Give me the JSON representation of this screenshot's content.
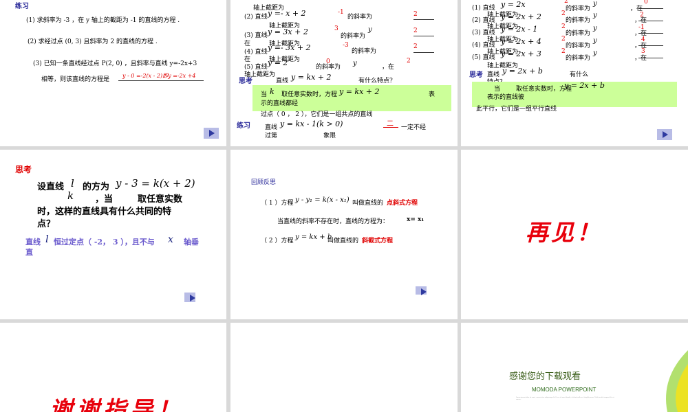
{
  "slide1": {
    "heading": "练习",
    "q1": "(1) 求斜率为 -3 ，在 y 轴上的截距为 -1 的直线的方程 .",
    "q2": "(2) 求经过点 (0, 3) 且斜率为 2 的直线的方程 .",
    "q3a": "(3) 已知一条直线经过点 P(2, 0) ，且斜率与直线 y=-2x+3",
    "q3b": "相等，则该直线的方程是",
    "q3ans": "y - 0 =-2(x - 2)即y =-2x +4"
  },
  "slide2": {
    "r2a": "(2) 直线",
    "r2eq": "y =- x + 2",
    "r2k": "-1",
    "r2s": "的斜率为",
    "r2b": "2",
    "r2c": "轴上截距为",
    "r3a": "(3) 直线",
    "r3eq": "y = 3x + 2",
    "r3k": "3",
    "r3s": "的斜率为",
    "r3y": "y",
    "r3b": "2",
    "r3c": "在",
    "r3d": "轴上截距为",
    "r4a": "(4) 直线",
    "r4eq": "y =- 3x + 2",
    "r4k": "-3",
    "r4s": "的斜率为",
    "r4b": "2",
    "r4c": "在",
    "r4d": "轴上截距为",
    "r5a": "(5) 直线",
    "r5eq": "y = 2",
    "r5k": "0",
    "r5s": "的斜率为",
    "r5y": "y",
    "r5z": "，在",
    "r5b": "2",
    "r5c": "轴上截距为",
    "r1c": "轴上截距为",
    "think": "思考",
    "think_line": "直线",
    "think_eq": "y = kx + 2",
    "think_q": "有什么特点?",
    "box1a": "当",
    "box1k": "k",
    "box1b": "取任意实数时，方程",
    "box1eq": "y = kx + 2",
    "box1c": "表",
    "box1d": "示的直线都经",
    "pt_line": "过点（ 0 ， 2 ），它们是一组共点的直线",
    "ex": "练习",
    "ex_line": "直线",
    "ex_eq": "y = kx - 1(k > 0)",
    "ex_ans": "二",
    "ex_end": "一定不经",
    "ex_b": "过第",
    "ex_c": "象限"
  },
  "slide3": {
    "r1": "(1) 直线",
    "r1eq": "y = 2x",
    "r1k": "2",
    "r1s": "的斜率为",
    "r1y": "y",
    "r1z": "，在",
    "r1b": "0",
    "r1c": "轴上截距为",
    "r2": "(2) 直线",
    "r2eq": "y = 2x + 2",
    "r2k": "2",
    "r2b": "2",
    "r3": "(3) 直线",
    "r3eq": "y = 2x - 1",
    "r3k": "2",
    "r3b": "-1",
    "r4": "(4) 直线",
    "r4eq": "y = 2x + 4",
    "r4k": "2",
    "r4b": "4",
    "r5": "(5) 直线",
    "r5eq": "y = 2x + 3",
    "r5k": "2",
    "r5b": "3",
    "r5c": "轴上截距为",
    "think": "思考",
    "think_line": "直线",
    "think_eq": "y = 2x + b",
    "think_q": "有什么",
    "think_q2": "特点？",
    "box_a": "当",
    "box_b": "取任意实数时，方程",
    "box_eq": "y = 2x + b",
    "box_c": "表示的直线彼",
    "par_line": "此平行，它们是一组平行直线"
  },
  "slide4": {
    "heading": "思考",
    "l1a": "设直线",
    "l1l": "l",
    "l1b": "的方为",
    "l1eq": "y - 3 = k(x + 2)",
    "l2k": "k",
    "l2a": "，当",
    "l2b": "取任意实数",
    "l3": "时，这样的直线具有什么共同的特",
    "l4": "点？",
    "ans_a": "直线",
    "ans_l": "l",
    "ans_b": "恒过定点（ -2， 3 ），且不与",
    "ans_x": "x",
    "ans_c": "轴垂",
    "ans_d": "直"
  },
  "slide5": {
    "heading": "回顾反思",
    "p1a": "（ 1 ）方程",
    "p1eq": "y - y₁ = k(x - x₁)",
    "p1b": "叫做直线的",
    "p1red": "点斜式方程",
    "p2": "当直线的斜率不存在时，直线的方程为：",
    "p2eq": "x= x₁",
    "p3a": "（ 2 ）方程",
    "p3eq": "y = kx + b",
    "p3b": "叫做直线的",
    "p3red": "斜截式方程"
  },
  "slide6": {
    "text": "再见！"
  },
  "slide7": {
    "text": "谢谢指导！"
  },
  "slide9": {
    "title": "感谢您的下载观看",
    "brand": "MOMODA POWERPOINT",
    "fine": "Lorem ipsum dolor sit amet, consectetur adipiscing elit. Fusce id urna blandit, eleifend nulla ac, fringilla purus. Nulla iaculis tempor felis ut cursus."
  }
}
